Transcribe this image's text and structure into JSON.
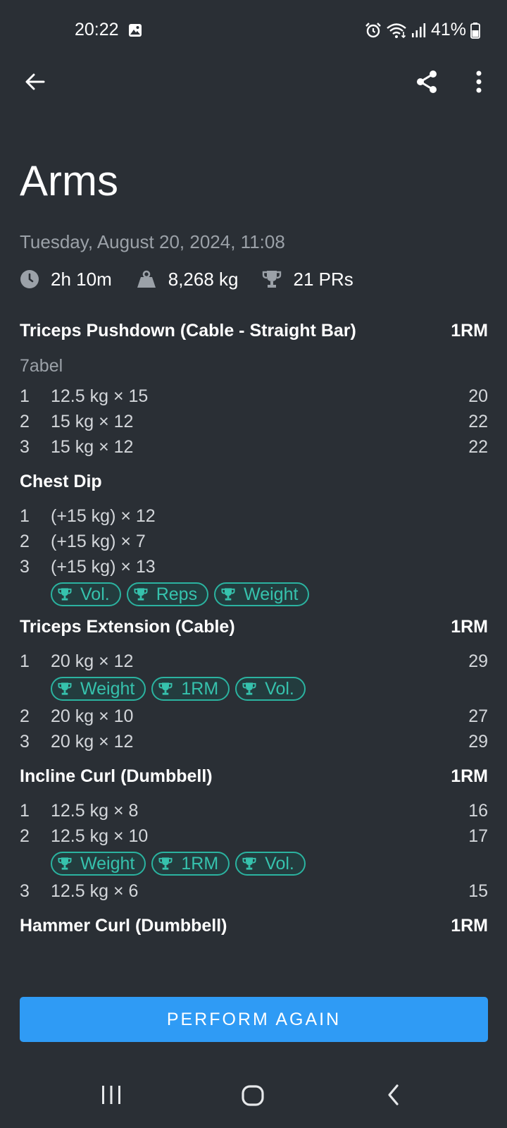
{
  "status_bar": {
    "time": "20:22",
    "battery": "41%",
    "icons": [
      "gallery-icon",
      "alarm-icon",
      "wifi-icon",
      "signal-icon",
      "battery-icon"
    ]
  },
  "app_bar": {
    "icons": [
      "back-arrow-icon",
      "share-icon",
      "more-vert-icon"
    ]
  },
  "workout": {
    "title": "Arms",
    "date": "Tuesday, August 20, 2024, 11:08",
    "stats": {
      "duration": "2h 10m",
      "volume": "8,268 kg",
      "prs": "21 PRs"
    }
  },
  "exercises": [
    {
      "name": "Triceps Pushdown (Cable - Straight Bar)",
      "column": "1RM",
      "note": "7abel",
      "sets": [
        {
          "num": "1",
          "value": "12.5 kg × 15",
          "rm": "20"
        },
        {
          "num": "2",
          "value": "15 kg × 12",
          "rm": "22"
        },
        {
          "num": "3",
          "value": "15 kg × 12",
          "rm": "22"
        }
      ]
    },
    {
      "name": "Chest Dip",
      "column": "",
      "sets": [
        {
          "num": "1",
          "value": "(+15 kg) × 12",
          "rm": ""
        },
        {
          "num": "2",
          "value": "(+15 kg) × 7",
          "rm": ""
        },
        {
          "num": "3",
          "value": "(+15 kg) × 13",
          "rm": "",
          "badges": [
            "Vol.",
            "Reps",
            "Weight"
          ]
        }
      ]
    },
    {
      "name": "Triceps Extension (Cable)",
      "column": "1RM",
      "sets": [
        {
          "num": "1",
          "value": "20 kg × 12",
          "rm": "29",
          "badges": [
            "Weight",
            "1RM",
            "Vol."
          ]
        },
        {
          "num": "2",
          "value": "20 kg × 10",
          "rm": "27"
        },
        {
          "num": "3",
          "value": "20 kg × 12",
          "rm": "29"
        }
      ]
    },
    {
      "name": "Incline Curl (Dumbbell)",
      "column": "1RM",
      "sets": [
        {
          "num": "1",
          "value": "12.5 kg × 8",
          "rm": "16"
        },
        {
          "num": "2",
          "value": "12.5 kg × 10",
          "rm": "17",
          "badges": [
            "Weight",
            "1RM",
            "Vol."
          ]
        },
        {
          "num": "3",
          "value": "12.5 kg × 6",
          "rm": "15"
        }
      ]
    },
    {
      "name": "Hammer Curl (Dumbbell)",
      "column": "1RM",
      "sets": []
    }
  ],
  "actions": {
    "perform_again": "PERFORM AGAIN"
  },
  "nav_bar": {
    "icons": [
      "recents-icon",
      "home-icon",
      "nav-back-icon"
    ]
  },
  "colors": {
    "background": "#2a2f35",
    "accent": "#2f9bf5",
    "pr_badge": "#36c2ad",
    "secondary_text": "#9ba1a8"
  }
}
